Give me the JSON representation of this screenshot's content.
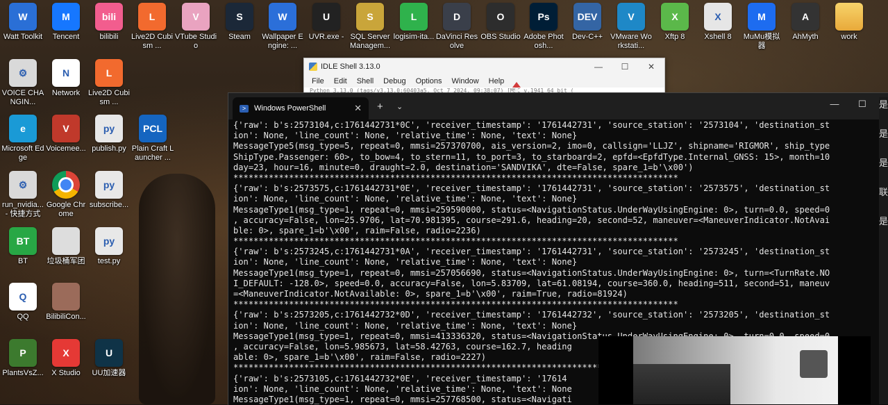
{
  "desktop": {
    "icons": [
      {
        "label": "Watt Toolkit",
        "glyph": "W",
        "color": "#2a6fd6"
      },
      {
        "label": "Tencent",
        "glyph": "M",
        "color": "#1677ff"
      },
      {
        "label": "bilibili",
        "glyph": "bili",
        "color": "#f25d8e"
      },
      {
        "label": "Live2D Cubism ...",
        "glyph": "L",
        "color": "#f26a2e"
      },
      {
        "label": "VTube Studio",
        "glyph": "V",
        "color": "#e9a3c0"
      },
      {
        "label": "Steam",
        "glyph": "S",
        "color": "#1b2838"
      },
      {
        "label": "Wallpaper Engine: ...",
        "glyph": "W",
        "color": "#2b6fd9"
      },
      {
        "label": "UVR.exe -",
        "glyph": "U",
        "color": "#222222"
      },
      {
        "label": "SQL Server Managem...",
        "glyph": "S",
        "color": "#c9a53a"
      },
      {
        "label": "logisim-ita...",
        "glyph": "L",
        "color": "#2fb24c"
      },
      {
        "label": "DaVinci Resolve",
        "glyph": "D",
        "color": "#3a3f4a"
      },
      {
        "label": "OBS Studio",
        "glyph": "O",
        "color": "#2d2d2d"
      },
      {
        "label": "Adobe Photosh...",
        "glyph": "Ps",
        "color": "#001e36"
      },
      {
        "label": "Dev-C++",
        "glyph": "DEV",
        "color": "#3465a4"
      },
      {
        "label": "VMware Workstati...",
        "glyph": "V",
        "color": "#1e88c7"
      },
      {
        "label": "Xftp 8",
        "glyph": "X",
        "color": "#5bb84a"
      },
      {
        "label": "Xshell 8",
        "glyph": "X",
        "color": "#e6e6e6"
      },
      {
        "label": "MuMu模拟器",
        "glyph": "M",
        "color": "#1d6cf0"
      },
      {
        "label": "AhMyth",
        "glyph": "A",
        "color": "#333333"
      },
      {
        "label": "work",
        "glyph": "",
        "color": "#f2c14e"
      },
      {
        "label": "VOICE CHANGIN...",
        "glyph": "⚙",
        "color": "#d9d9d9"
      },
      {
        "label": "Network",
        "glyph": "N",
        "color": "#ffffff"
      },
      {
        "label": "Live2D Cubism ...",
        "glyph": "L",
        "color": "#f26a2e"
      },
      {
        "label": "Microsoft Edge",
        "glyph": "e",
        "color": "#1a9ad6"
      },
      {
        "label": "Voicemee...",
        "glyph": "V",
        "color": "#c0392b"
      },
      {
        "label": "publish.py",
        "glyph": "py",
        "color": "#e8e8e8"
      },
      {
        "label": "Plain Craft Launcher ...",
        "glyph": "PCL",
        "color": "#1565c0"
      },
      {
        "label": "run_nvidia... - 快捷方式",
        "glyph": "⚙",
        "color": "#d9d9d9"
      },
      {
        "label": "Google Chrome",
        "glyph": "",
        "color": "#ffffff"
      },
      {
        "label": "subscribe...",
        "glyph": "py",
        "color": "#e8e8e8"
      },
      {
        "label": "BT",
        "glyph": "BT",
        "color": "#28a745"
      },
      {
        "label": "垃圾桶军团",
        "glyph": "",
        "color": "#dddddd"
      },
      {
        "label": "test.py",
        "glyph": "py",
        "color": "#e8e8e8"
      },
      {
        "label": "QQ",
        "glyph": "Q",
        "color": "#ffffff"
      },
      {
        "label": "BilibiliCon...",
        "glyph": "",
        "color": "#9b6b5a"
      },
      {
        "label": "PlantsVsZ...",
        "glyph": "P",
        "color": "#3c7a2e"
      },
      {
        "label": "X Studio",
        "glyph": "X",
        "color": "#e53935"
      },
      {
        "label": "UU加速器",
        "glyph": "U",
        "color": "#0f3347"
      }
    ]
  },
  "idle": {
    "title": "IDLE Shell 3.13.0",
    "menu": [
      "File",
      "Edit",
      "Shell",
      "Debug",
      "Options",
      "Window",
      "Help"
    ],
    "peek_text": "Python 3.13.0 (tags/v3.13.0:60403a5, Oct  7 2024, 09:38:07) [MSC v.1941 64 bit (",
    "minimize": "—",
    "maximize": "☐",
    "close": "✕"
  },
  "terminal": {
    "tab_title": "Windows PowerShell",
    "tab_close": "✕",
    "new_tab": "+",
    "dropdown": "⌄",
    "minimize": "—",
    "maximize": "☐",
    "lines": [
      "{'raw': b's:2573104,c:1761442731*0C', 'receiver_timestamp': '1761442731', 'source_station': '2573104', 'destination_st",
      "ion': None, 'line_count': None, 'relative_time': None, 'text': None}",
      "MessageType5(msg_type=5, repeat=0, mmsi=257370700, ais_version=2, imo=0, callsign='LLJZ', shipname='RIGMOR', ship_type",
      "ShipType.Passenger: 60>, to_bow=4, to_stern=11, to_port=3, to_starboard=2, epfd=<EpfdType.Internal_GNSS: 15>, month=10",
      "day=23, hour=16, minute=0, draught=2.0, destination='SANDVIKA', dte=False, spare_1=b'\\x00')",
      "****************************************************************************************",
      "{'raw': b's:2573575,c:1761442731*0E', 'receiver_timestamp': '1761442731', 'source_station': '2573575', 'destination_st",
      "ion': None, 'line_count': None, 'relative_time': None, 'text': None}",
      "MessageType1(msg_type=1, repeat=0, mmsi=259590000, status=<NavigationStatus.UnderWayUsingEngine: 0>, turn=0.0, speed=0",
      ", accuracy=False, lon=25.9706, lat=70.981395, course=291.6, heading=20, second=52, maneuver=<ManeuverIndicator.NotAvai",
      "ble: 0>, spare_1=b'\\x00', raim=False, radio=2236)",
      "****************************************************************************************",
      "{'raw': b's:2573245,c:1761442731*0A', 'receiver_timestamp': '1761442731', 'source_station': '2573245', 'destination_st",
      "ion': None, 'line_count': None, 'relative_time': None, 'text': None}",
      "MessageType1(msg_type=1, repeat=0, mmsi=257056690, status=<NavigationStatus.UnderWayUsingEngine: 0>, turn=<TurnRate.NO",
      "I_DEFAULT: -128.0>, speed=0.0, accuracy=False, lon=5.83709, lat=61.08194, course=360.0, heading=511, second=51, maneuv",
      "=<ManeuverIndicator.NotAvailable: 0>, spare_1=b'\\x00', raim=True, radio=81924)",
      "****************************************************************************************",
      "{'raw': b's:2573205,c:1761442732*0D', 'receiver_timestamp': '1761442732', 'source_station': '2573205', 'destination_st",
      "ion': None, 'line_count': None, 'relative_time': None, 'text': None}",
      "MessageType1(msg_type=1, repeat=0, mmsi=413336320, status=<NavigationStatus.UnderWayUsingEngine: 0>, turn=0.0, speed=0",
      ", accuracy=False, lon=5.985673, lat=58.42763, course=162.7, heading",
      "able: 0>, spare_1=b'\\x00', raim=False, radio=2227)",
      "****************************************************************************************",
      "{'raw': b's:2573105,c:1761442732*0E', 'receiver_timestamp': '17614",
      "ion': None, 'line_count': None, 'relative_time': None, 'text': None",
      "MessageType1(msg_type=1, repeat=0, mmsi=257768500, status=<Navigati"
    ]
  },
  "edge_glyphs": [
    "是",
    "是",
    "是",
    "联",
    "是"
  ]
}
